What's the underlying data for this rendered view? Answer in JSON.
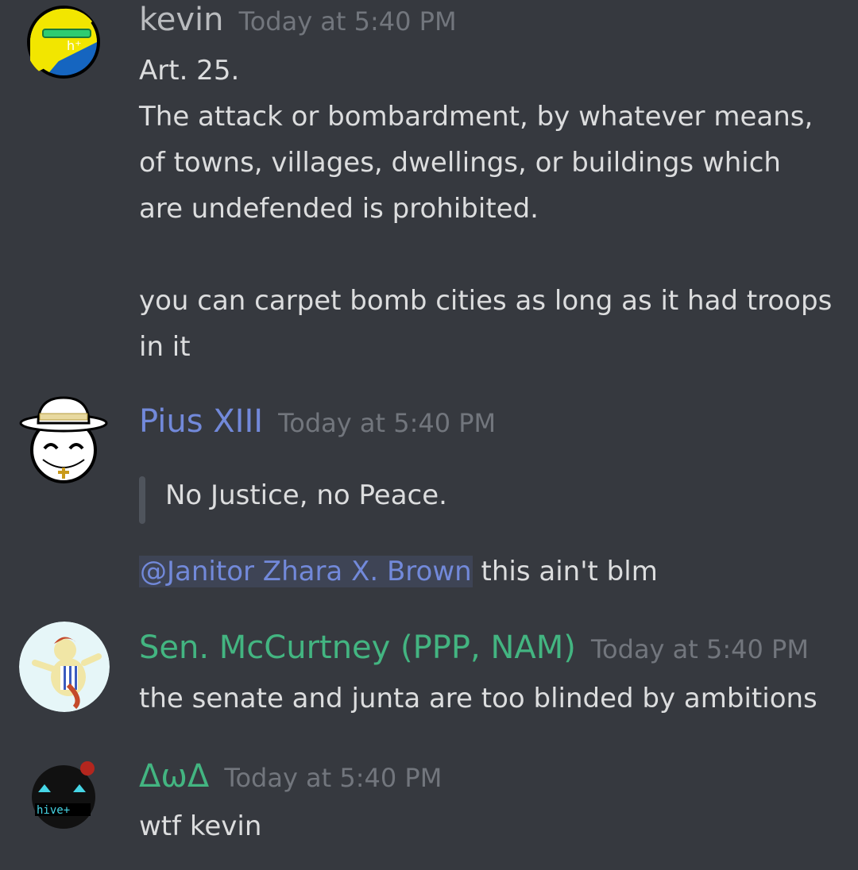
{
  "messages": [
    {
      "author": "kevin",
      "author_color": "#b9bbbe",
      "timestamp": "Today at 5:40 PM",
      "avatar_badge": "h⁺",
      "lines": [
        "Art. 25.",
        "The attack or bombardment, by whatever means,",
        "of towns, villages, dwellings, or buildings which",
        "are undefended is prohibited.",
        "",
        "you can carpet bomb cities as long as it had troops",
        "in it"
      ]
    },
    {
      "author": "Pius XIII",
      "author_color": "#7289da",
      "timestamp": "Today at 5:40 PM",
      "quote": "No Justice, no Peace.",
      "mention": "@Janitor Zhara X. Brown",
      "text_after_mention": " this ain't blm"
    },
    {
      "author": "Sen. McCurtney (PPP, NAM)",
      "author_color": "#43b581",
      "timestamp": "Today at 5:40 PM",
      "lines": [
        "the senate and junta are too blinded by ambitions"
      ]
    },
    {
      "author": "ΔωΔ",
      "author_color": "#43b581",
      "timestamp": "Today at 5:40 PM",
      "avatar_badge": "hive+",
      "lines": [
        "wtf kevin"
      ]
    }
  ]
}
